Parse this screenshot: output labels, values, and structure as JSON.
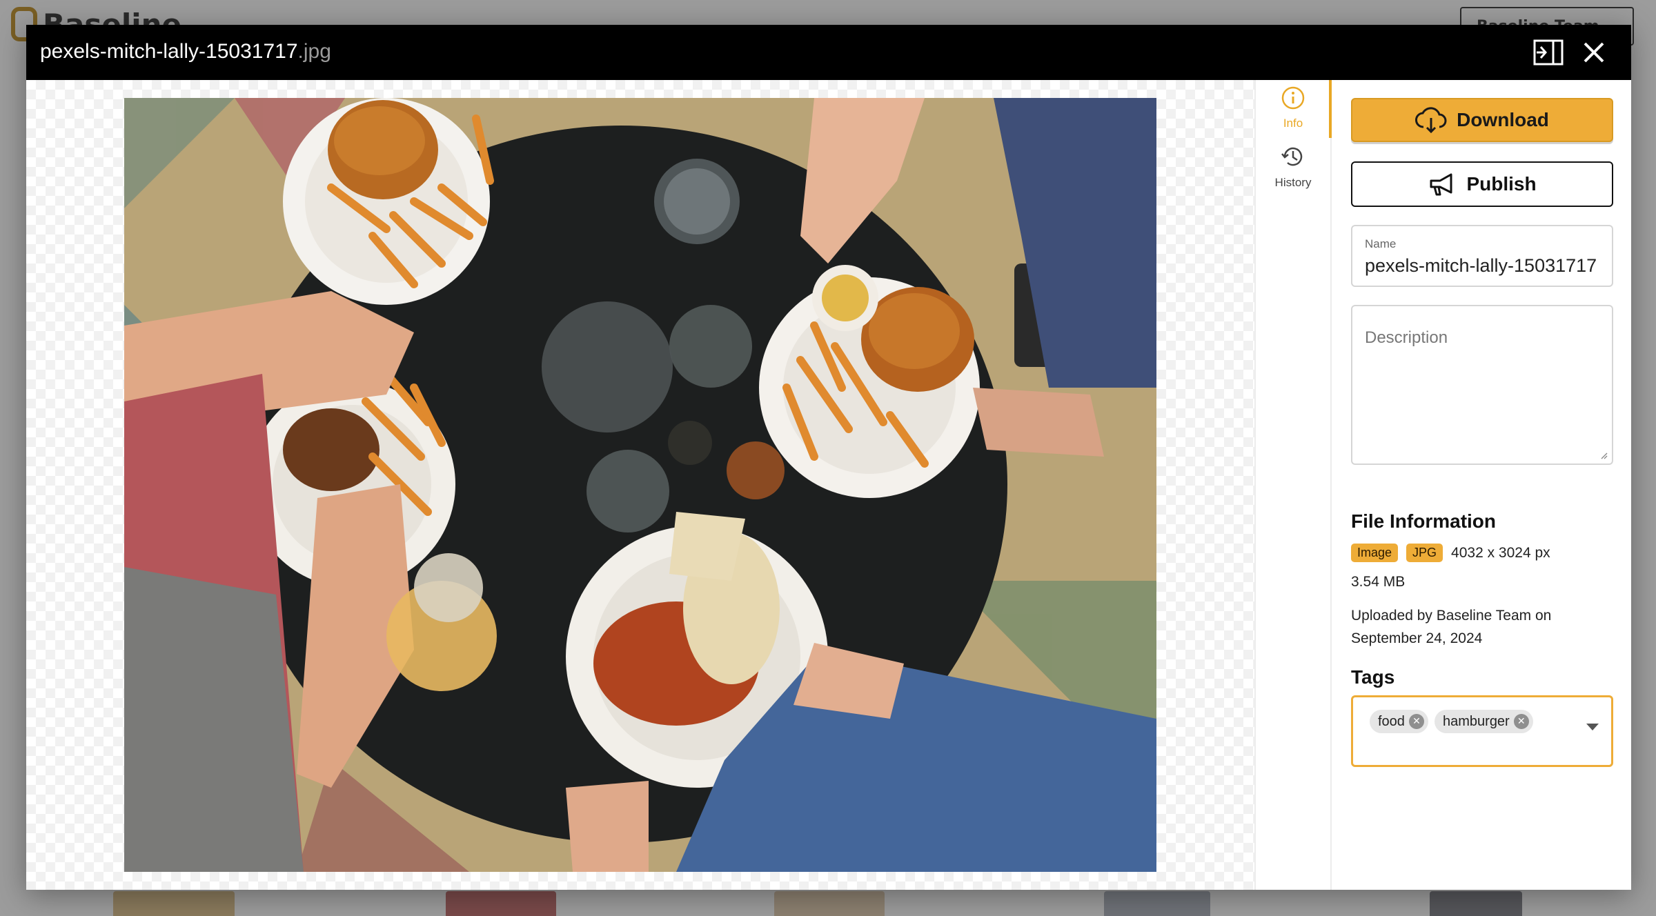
{
  "background": {
    "brand": "Baseline",
    "team_selector": "Baseline Team"
  },
  "header": {
    "file_basename": "pexels-mitch-lally-15031717",
    "file_extension": ".jpg",
    "collapse_icon": "panel-collapse-icon",
    "close_icon": "close-icon"
  },
  "side_tabs": [
    {
      "label": "Info",
      "icon": "info-icon",
      "active": true
    },
    {
      "label": "History",
      "icon": "history-icon",
      "active": false
    }
  ],
  "actions": {
    "download_label": "Download",
    "publish_label": "Publish"
  },
  "fields": {
    "name_label": "Name",
    "name_value": "pexels-mitch-lally-15031717",
    "description_placeholder": "Description"
  },
  "file_info": {
    "title": "File Information",
    "type_badge": "Image",
    "format_badge": "JPG",
    "dimensions": "4032 x 3024 px",
    "size": "3.54 MB",
    "uploaded": "Uploaded by Baseline Team on September 24, 2024"
  },
  "tags": {
    "title": "Tags",
    "items": [
      "food",
      "hamburger"
    ]
  },
  "colors": {
    "accent": "#eeac37",
    "header_bg": "#000000"
  }
}
